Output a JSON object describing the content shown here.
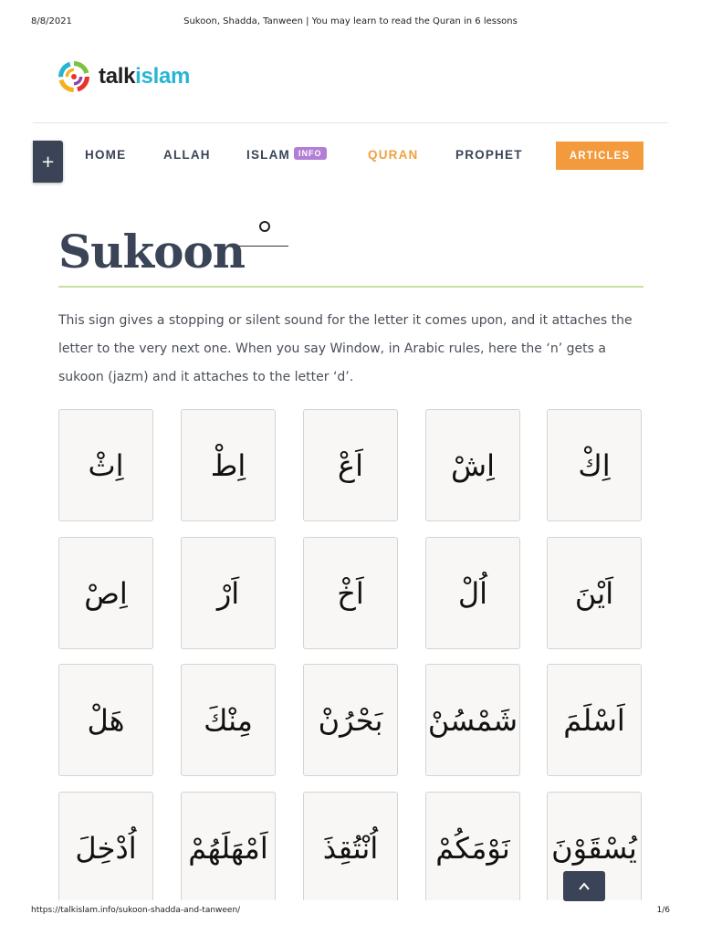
{
  "print": {
    "date": "8/8/2021",
    "doc_title": "Sukoon, Shadda, Tanween | You may learn to read the Quran in 6 lessons",
    "url": "https://talkislam.info/sukoon-shadda-and-tanween/",
    "page": "1/6"
  },
  "logo": {
    "part1": "talk",
    "part2": "islam"
  },
  "nav": {
    "plus": "+",
    "items": [
      "HOME",
      "ALLAH",
      "ISLAM",
      "QURAN",
      "PROPHET"
    ],
    "info_badge": "INFO",
    "articles": "ARTICLES"
  },
  "section": {
    "title": "Sukoon",
    "body": "This sign gives a stopping or silent sound for the letter it comes upon, and it attaches the letter to the very next one. When you say Window, in Arabic rules, here the ‘n’ gets a sukoon (jazm) and it attaches to the letter ‘d’."
  },
  "cards": [
    [
      "اِكْ",
      "اِشْ",
      "اَعْ",
      "اِطْ",
      "اِثْ"
    ],
    [
      "اَيْنَ",
      "اُلْ",
      "اَخْ",
      "اَرْ",
      "اِصْ"
    ],
    [
      "اَسْلَمَ",
      "شَمْسُنْ",
      "بَحْرُنْ",
      "مِنْكَ",
      "هَلْ"
    ],
    [
      "يُسْقَوْنَ",
      "نَوْمَكُمْ",
      "اُنْتُقِذَ",
      "اَمْهَلَهُمْ",
      "اُدْخِلَ"
    ]
  ],
  "colors": {
    "nav_text": "#3a4456",
    "nav_active": "#f0a040",
    "articles_bg": "#f39a3c",
    "info_badge_bg": "#b37fd6",
    "rule": "#c3e19f",
    "logo_accent": "#27b5d3"
  },
  "icons": {
    "scroll_top": "chevron-up-icon",
    "logo": "talkislam-logo-icon"
  }
}
